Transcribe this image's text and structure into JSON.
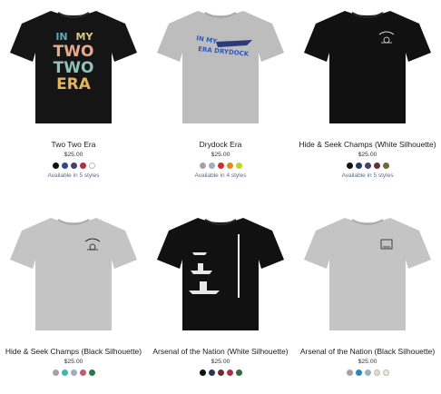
{
  "products": [
    {
      "title": "Two Two Era",
      "price": "$25.00",
      "styles_text": "Available in 5 styles",
      "shirt_color": "#151515",
      "swatches": [
        "#111111",
        "#2a4b8d",
        "#4b3d6d",
        "#b22d4a",
        "#ffffff"
      ],
      "graphic": "retro-text-two-two-era",
      "graphic_text": [
        "IN",
        "MY",
        "TWO",
        "TWO",
        "ERA"
      ]
    },
    {
      "title": "Drydock Era",
      "price": "$25.00",
      "styles_text": "Available in 4 styles",
      "shirt_color": "#bdbdbd",
      "swatches": [
        "#a3a3a3",
        "#9bb0c0",
        "#d12b2b",
        "#e38a12",
        "#b9d92b"
      ],
      "graphic": "ship-drydock-era",
      "graphic_text": [
        "IN MY",
        "ERA DRYDOCK"
      ]
    },
    {
      "title": "Hide & Seek Champs (White Silhouette)",
      "price": "$25.00",
      "styles_text": "Available in 5 styles",
      "shirt_color": "#111111",
      "swatches": [
        "#111111",
        "#243a63",
        "#4b3d6d",
        "#6b2c33",
        "#6b6b3a"
      ],
      "graphic": "small-chest-logo-white",
      "graphic_text": []
    },
    {
      "title": "Hide & Seek Champs (Black Silhouette)",
      "price": "$25.00",
      "styles_text": "",
      "shirt_color": "#c4c4c4",
      "swatches": [
        "#a3a3a3",
        "#3fb7b0",
        "#9bb0c0",
        "#c05a78",
        "#2a7a4e"
      ],
      "graphic": "small-chest-logo-black",
      "graphic_text": []
    },
    {
      "title": "Arsenal of the Nation (White Silhouette)",
      "price": "$25.00",
      "styles_text": "",
      "shirt_color": "#111111",
      "swatches": [
        "#111111",
        "#243a63",
        "#6b2c33",
        "#b22d4a",
        "#2f6b3a"
      ],
      "graphic": "ships-white",
      "graphic_text": []
    },
    {
      "title": "Arsenal of the Nation (Black Silhouette)",
      "price": "$25.00",
      "styles_text": "",
      "shirt_color": "#c4c4c4",
      "swatches": [
        "#a3a3a3",
        "#2e86c1",
        "#9bb0c0",
        "#e8d9c0",
        "#f1e6d6"
      ],
      "graphic": "small-chest-logo-black",
      "graphic_text": []
    }
  ]
}
